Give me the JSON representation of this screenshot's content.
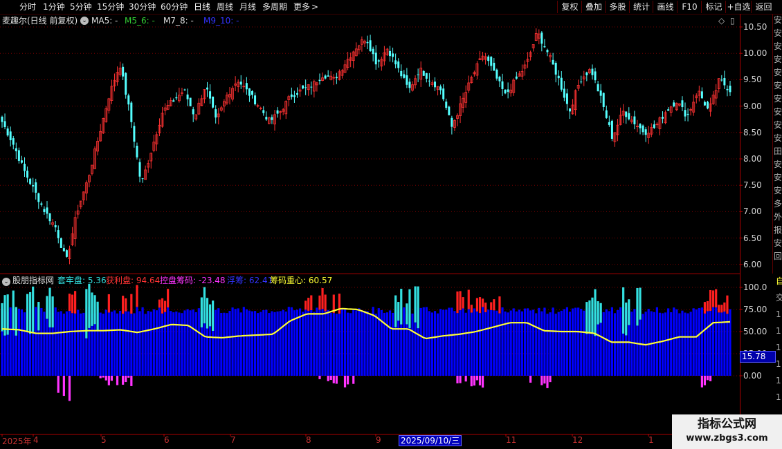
{
  "toolbar": {
    "items": [
      "分时",
      "1分钟",
      "5分钟",
      "15分钟",
      "30分钟",
      "60分钟",
      "日线",
      "周线",
      "月线",
      "多周期",
      "更多"
    ],
    "more_arrow": ">",
    "right_buttons": [
      "复权",
      "叠加",
      "多股",
      "统计",
      "画线",
      "F10",
      "标记",
      "+自选",
      "返回"
    ]
  },
  "main_panel": {
    "title": "麦趣尔(日线 前复权)",
    "ma_labels": [
      {
        "text": "MA5: -",
        "color": "#e0e0e0"
      },
      {
        "text": "M5_6: -",
        "color": "#33cc33"
      },
      {
        "text": "M7_8: -",
        "color": "#e0e0e0"
      },
      {
        "text": "M9_10: -",
        "color": "#3333ff"
      }
    ],
    "y_ticks": [
      "10.50",
      "10.00",
      "9.50",
      "9.00",
      "8.50",
      "8.00",
      "7.50",
      "7.00",
      "6.50",
      "6.00"
    ],
    "diamond_icon": "◇",
    "toggle_icon": "▯"
  },
  "indicator_panel": {
    "title": "股朋指标网",
    "legends": [
      {
        "text": "套牢盘: 5.36",
        "color": "#33e0e0"
      },
      {
        "text": "获利盘: 94.64",
        "color": "#ff3333"
      },
      {
        "text": "控盘筹码: -23.48",
        "color": "#ff33ff"
      },
      {
        "text": "浮筹: 62.41",
        "color": "#3333ff"
      },
      {
        "text": "筹码重心: 60.57",
        "color": "#ffff33"
      }
    ],
    "y_ticks": [
      "100.0",
      "75.00",
      "50.00",
      "25.00",
      "0.00"
    ],
    "current_value": "15.78",
    "right_edge_chars": [
      "自",
      "交",
      "1",
      "1",
      "1",
      "1",
      "1",
      "1"
    ]
  },
  "x_axis": {
    "labels": [
      "2025年",
      "4",
      "5",
      "6",
      "7",
      "8",
      "9",
      "0",
      "11",
      "12",
      "1"
    ],
    "cursor_date": "2025/09/10/三"
  },
  "side_text": [
    "安",
    "安",
    "安",
    "安",
    "安",
    "安",
    "安",
    "安",
    "安",
    "安",
    "田",
    "安",
    "安",
    "安",
    "多",
    "外",
    "报",
    "安",
    "回"
  ],
  "watermark": {
    "line1": "指标公式网",
    "line2": "www.zbgs3.com"
  },
  "colors": {
    "up": "#ff3232",
    "down": "#54ffff",
    "grid": "#7a0000",
    "float": "#0000ff",
    "trapped": "#33e0e0",
    "profit": "#ff2020",
    "control": "#ff33ff",
    "center": "#ffff33"
  },
  "chart_data": {
    "type": "candlestick",
    "main_ylim": [
      5.85,
      10.6
    ],
    "price_path": [
      8.7,
      8.3,
      7.8,
      7.4,
      7.0,
      6.7,
      6.05,
      7.0,
      7.6,
      8.4,
      9.2,
      9.8,
      8.8,
      7.5,
      8.2,
      8.9,
      9.1,
      9.3,
      8.8,
      9.4,
      8.7,
      9.2,
      9.5,
      9.25,
      9.0,
      8.7,
      8.9,
      9.2,
      9.3,
      9.4,
      9.6,
      9.5,
      9.8,
      10.1,
      10.3,
      9.8,
      10.1,
      9.7,
      9.3,
      9.7,
      9.5,
      9.3,
      8.6,
      9.1,
      9.6,
      10.0,
      9.6,
      9.2,
      9.5,
      9.8,
      10.4,
      10.0,
      9.5,
      8.9,
      9.5,
      9.7,
      9.1,
      8.4,
      8.9,
      8.7,
      8.5,
      8.6,
      8.9,
      9.1,
      8.8,
      9.3,
      8.9,
      9.5,
      9.3
    ]
  }
}
